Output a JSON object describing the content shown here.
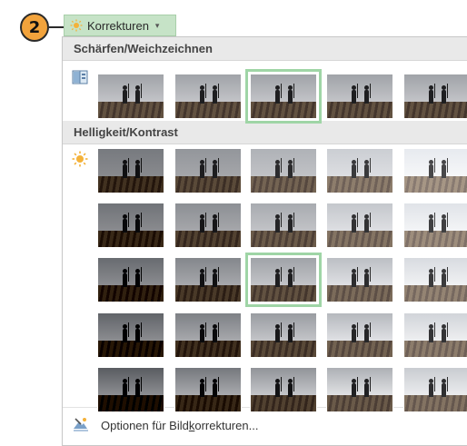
{
  "callout": {
    "step": "2"
  },
  "ribbon": {
    "button_label": "Korrekturen",
    "button_icon": "sun-icon",
    "dropdown_icon": "chevron-down-icon",
    "accent_color": "#c6e3c7"
  },
  "gallery": {
    "sections": [
      {
        "title": "Schärfen/Weichzeichnen",
        "icon": "sharpen-icon",
        "rows": 1,
        "columns": 5,
        "selected": {
          "row": 0,
          "column": 2
        }
      },
      {
        "title": "Helligkeit/Kontrast",
        "icon": "sun-icon",
        "rows": 5,
        "columns": 5,
        "selected": {
          "row": 2,
          "column": 2
        }
      }
    ],
    "selection_color": "#9fd5a6"
  },
  "footer": {
    "icon": "picture-correction-icon",
    "option_before": "Optionen für Bild",
    "option_accel": "k",
    "option_after": "orrekturen..."
  }
}
